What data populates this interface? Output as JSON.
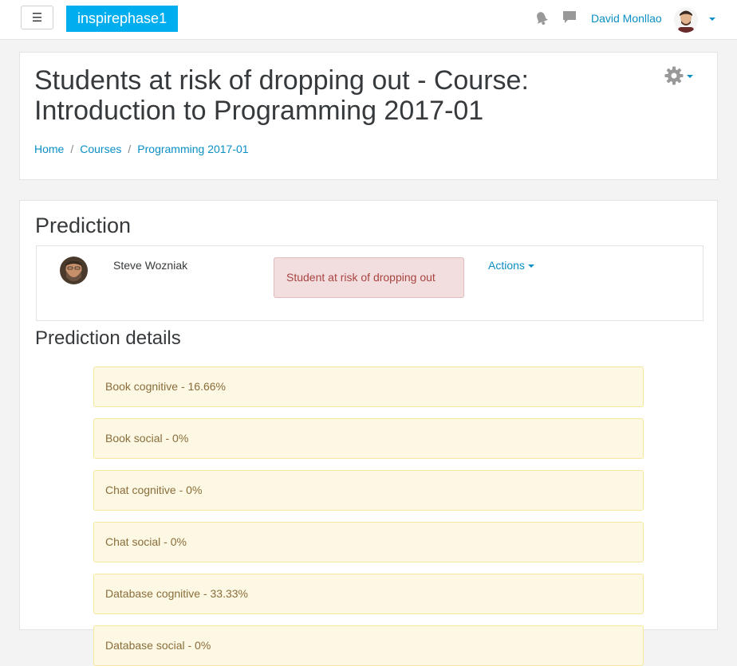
{
  "navbar": {
    "menu_icon": "hamburger-icon",
    "menu_glyph": "☰",
    "brand": "inspirephase1",
    "notifications_icon": "bell-icon",
    "messages_icon": "chat-bubble-icon",
    "user_name": "David Monllao",
    "user_menu_icon": "chevron-down-icon"
  },
  "header": {
    "title": "Students at risk of dropping out - Course: Introduction to Programming 2017-01",
    "settings_icon": "gear-icon",
    "breadcrumb": [
      "Home",
      "Courses",
      "Programming 2017-01"
    ],
    "breadcrumb_separator": "/"
  },
  "prediction": {
    "heading": "Prediction",
    "student_name": "Steve Wozniak",
    "outcome": "Student at risk of dropping out",
    "actions_label": "Actions"
  },
  "details": {
    "heading": "Prediction details",
    "items": [
      "Book cognitive - 16.66%",
      "Book social - 0%",
      "Chat cognitive - 0%",
      "Chat social - 0%",
      "Database cognitive - 33.33%",
      "Database social - 0%"
    ]
  },
  "colors": {
    "brand": "#00aeef",
    "link": "#0b8fc4",
    "danger_bg": "#f2dede",
    "danger_text": "#a94442",
    "warning_bg": "#fcf8e3",
    "warning_text": "#8a6d3b"
  }
}
